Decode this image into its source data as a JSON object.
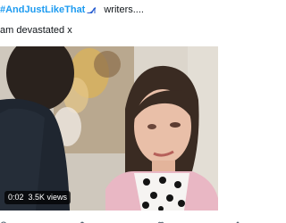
{
  "tweet": {
    "hashtag": "#AndJustLikeThat",
    "header_rest": "writers....",
    "body": "am devastated x",
    "heel_icon": "high-heel-icon"
  },
  "video": {
    "time": "0:02",
    "views": "3.5K views"
  },
  "actions": {
    "icons": [
      "reply-icon",
      "retweet-icon",
      "like-icon",
      "share-icon"
    ]
  },
  "colors": {
    "link": "#1d9bf0",
    "text": "#0f1419",
    "heel": "#2a5fd1"
  }
}
